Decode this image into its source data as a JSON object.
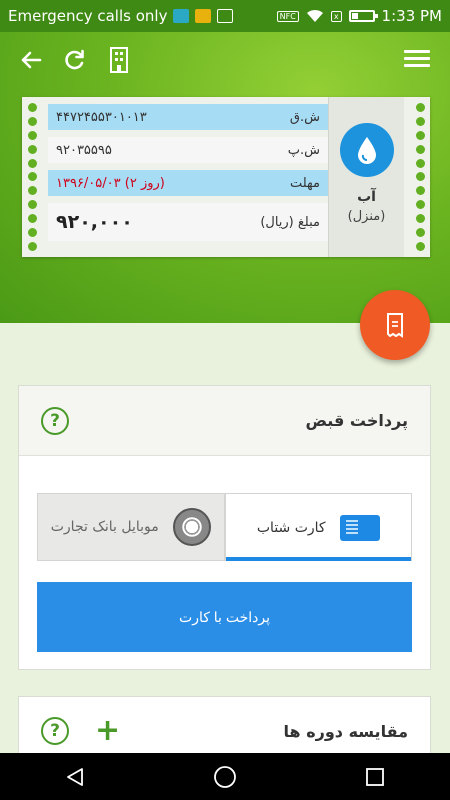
{
  "status_bar": {
    "carrier": "Emergency calls only",
    "nfc_label": "NFC",
    "time": "1:33 PM"
  },
  "toolbar": {
    "back_icon": "back-arrow-icon",
    "refresh_icon": "refresh-icon",
    "building_icon": "building-icon",
    "menu_icon": "hamburger-menu-icon"
  },
  "bill": {
    "service_name": "آب",
    "service_type": "(منزل)",
    "rows": [
      {
        "label": "ش.ق",
        "value": "۴۴۷۲۴۵۵۳۰۱۰۱۳"
      },
      {
        "label": "ش.پ",
        "value": "۹۲۰۳۵۵۹۵"
      },
      {
        "label": "مهلت",
        "value": "۱۳۹۶/۰۵/۰۳ (۲ روز)"
      },
      {
        "label": "مبلغ (ریال)",
        "value": "۹۲۰,۰۰۰"
      }
    ]
  },
  "payment": {
    "title": "پرداخت قبض",
    "tab_card": "کارت شتاب",
    "tab_mobile_bank": "موبایل بانک تجارت",
    "pay_button": "پرداخت با کارت"
  },
  "compare": {
    "title": "مقایسه دوره ها"
  },
  "colors": {
    "header_green": "#6cb521",
    "fab_orange": "#f05a24",
    "primary_blue": "#2a8ee6",
    "accent_green": "#4a9a2a"
  }
}
